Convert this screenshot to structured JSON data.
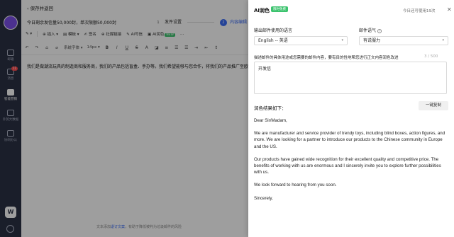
{
  "sidebar": {
    "items": [
      {
        "label": "邮箱"
      },
      {
        "label": "消息",
        "badge": "11"
      },
      {
        "label": "智能营销"
      },
      {
        "label": "外贸大数据"
      },
      {
        "label": "协同办公"
      }
    ],
    "logo": "W"
  },
  "editor": {
    "back_label": "保存并返回",
    "stats": "今日剩余发信量50,000封，单次限额50,000封",
    "steps": [
      {
        "number": "1",
        "label": "发件设置"
      },
      {
        "number": "2",
        "label": "内容编辑"
      }
    ],
    "toolbar1": {
      "insert": "插入",
      "template": "模板",
      "signature": "签名",
      "social": "社媒链接",
      "ai_write": "AI写信",
      "ai_polish": "AI润色",
      "new_tag": "NEW",
      "more": "..."
    },
    "toolbar2": {
      "font_family": "系统字体",
      "font_size": "14px"
    },
    "body_text": "我们是做潮流玩具的制造商和服务商，我们的产品包括盲盒、手办等。我们希望能够与您合作，将我们的产品推广至欧洲和美国",
    "footer_note": {
      "prefix": "文本添加",
      "link": "退订文案",
      "suffix": "，有助于降低被判为垃圾邮件的风险"
    }
  },
  "panel": {
    "title": "AI润色",
    "badge": "限时免费",
    "usage": "今日还可使用19次",
    "language_label": "输出邮件使用的语言",
    "language_value": "English -- 英语",
    "tone_label": "邮件语气",
    "tone_value": "有说服力",
    "desc_label": "描述邮件的具体用途或您需要的邮件内容，要有目的性地帮您进行正文内容润色改进",
    "desc_count": "3 / 500",
    "desc_value": "开发信",
    "result_title": "润色结果如下：",
    "copy_button": "一键复制",
    "result_paragraphs": [
      "Dear Sir/Madam,",
      "We are manufacturer and service provider of trendy toys, including blind boxes, action figures, and more. We are looking for a partner to introduce our products to the Chinese community in Europe and the US.",
      "Our products have gained wide recognition for their excellent quality and competitive price. The benefits of working with us are enormous and I sincerely invite you to explore further possibilities with us.",
      "We look forward to hearing from you soon.",
      "Sincerely,"
    ]
  }
}
